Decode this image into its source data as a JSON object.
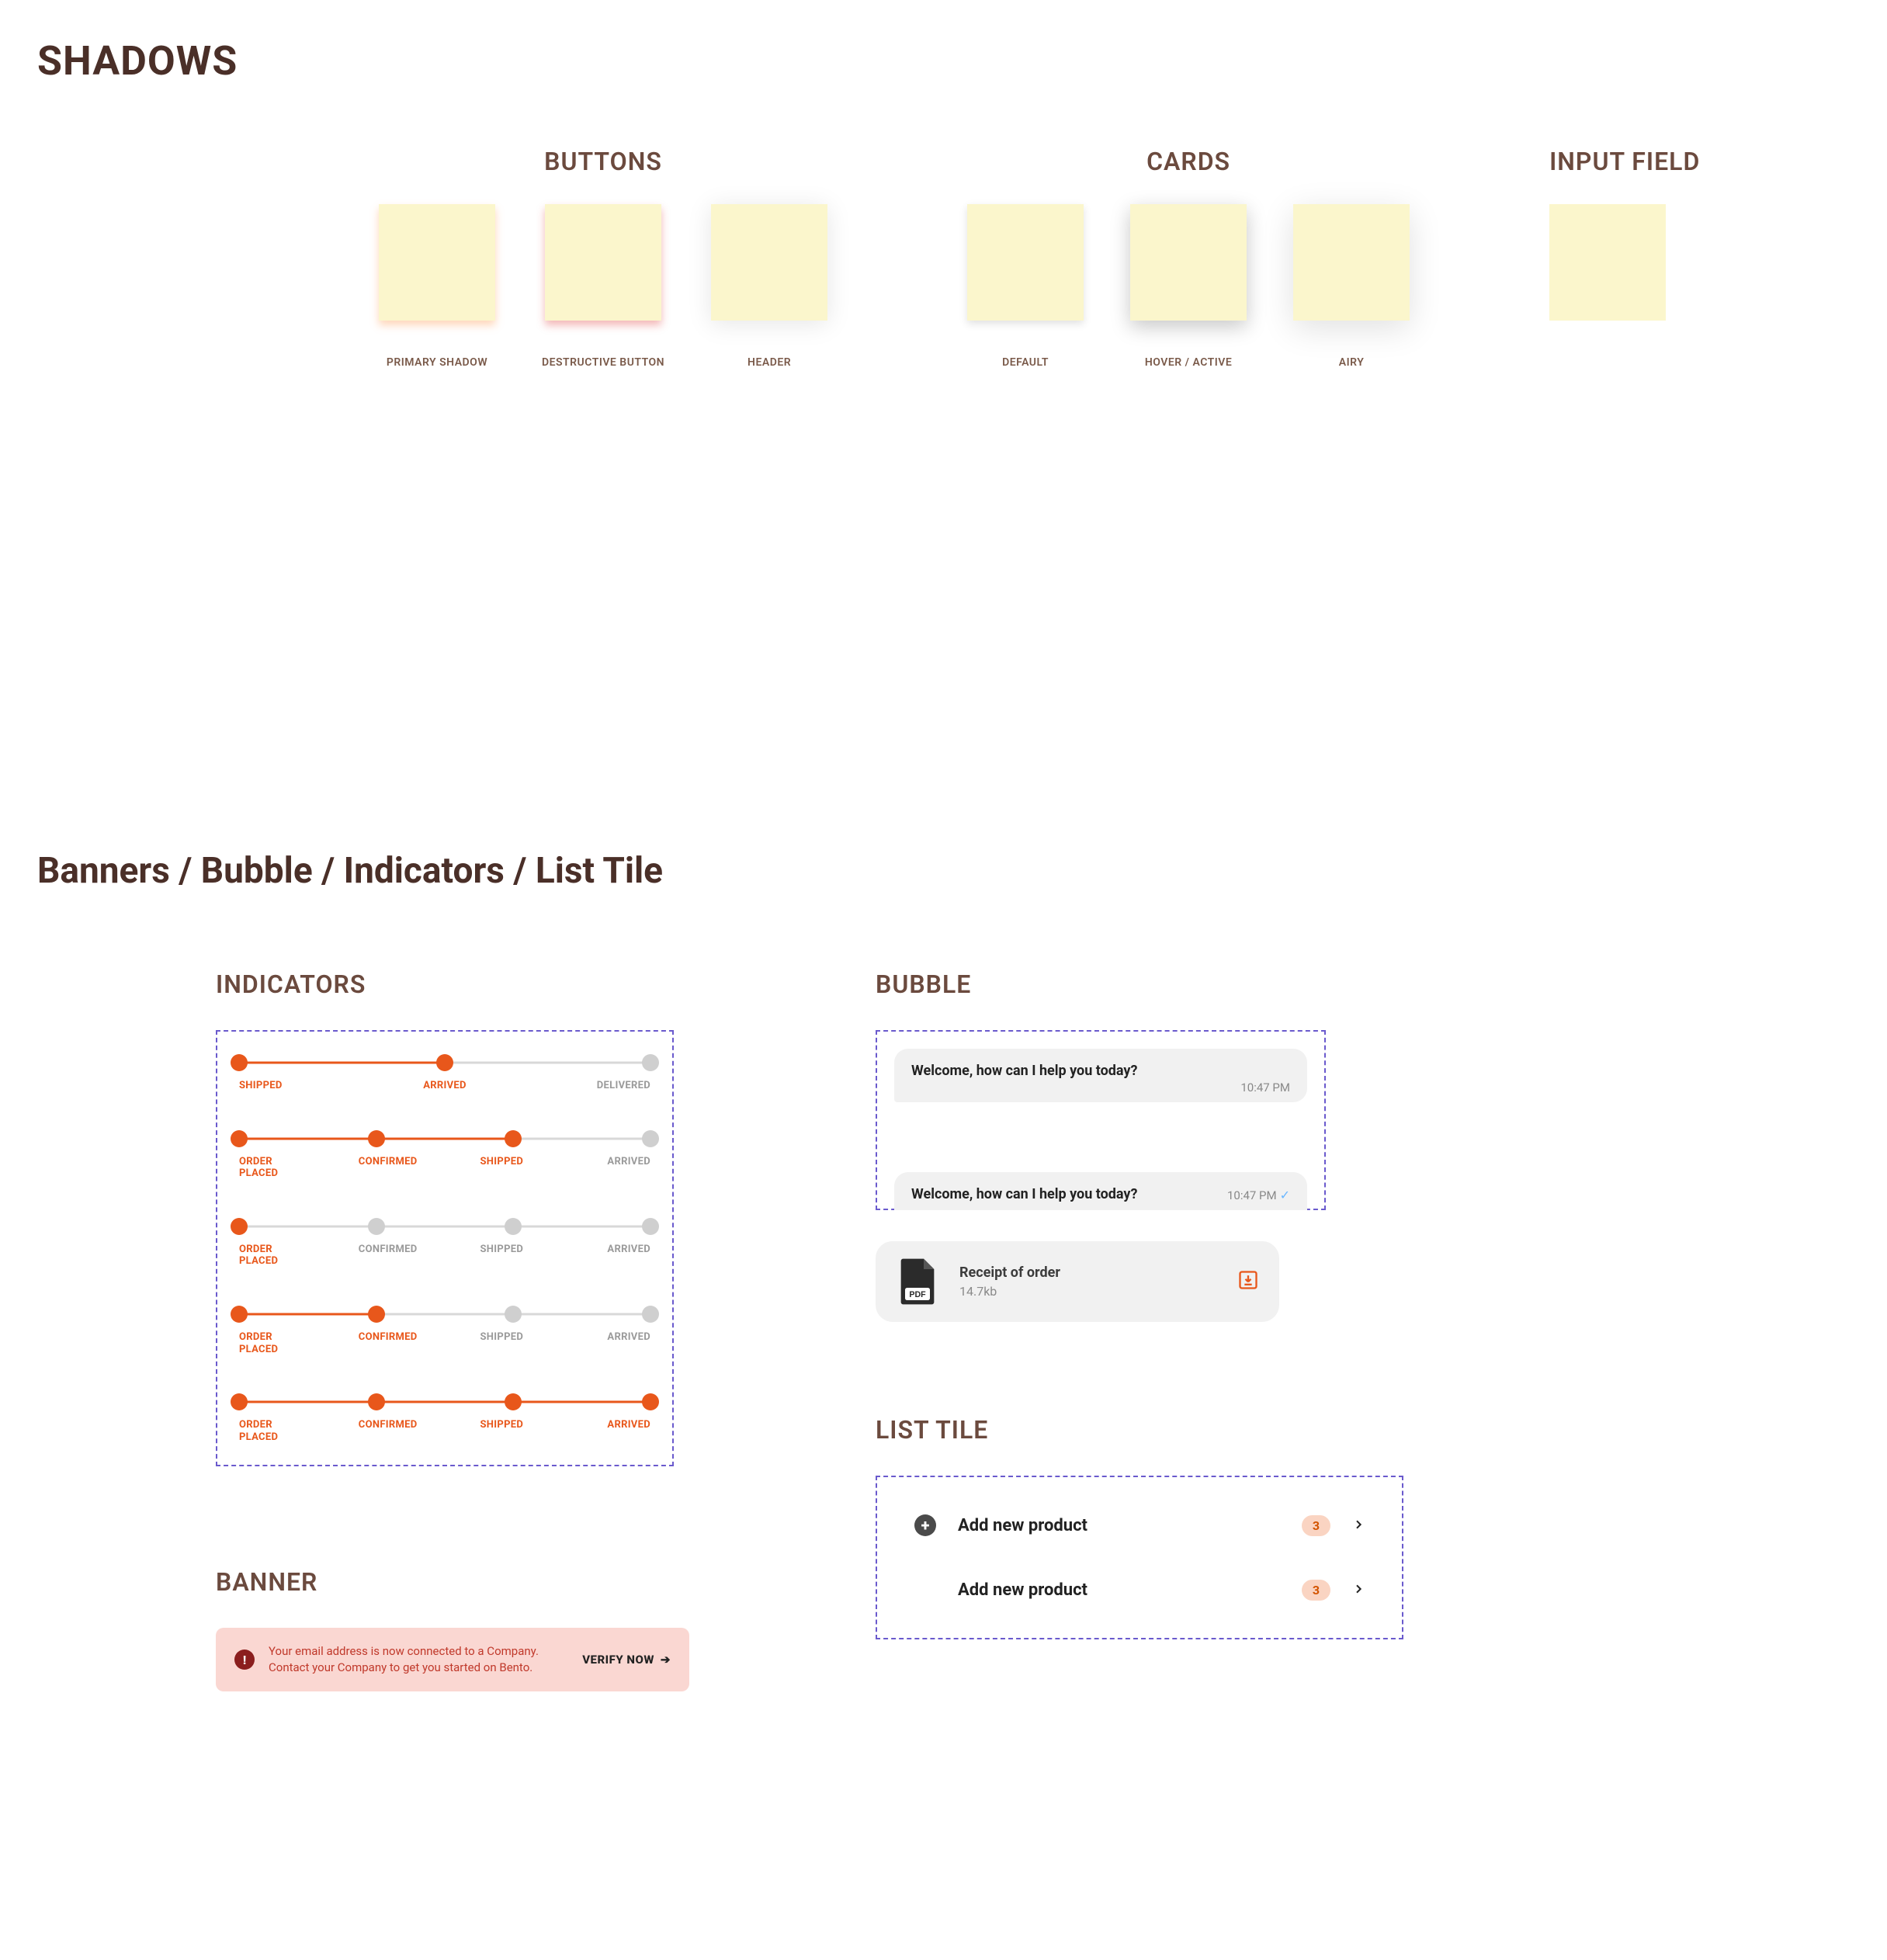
{
  "shadows": {
    "title": "SHADOWS",
    "groups": {
      "buttons": {
        "heading": "BUTTONS",
        "items": [
          {
            "label": "PRIMARY SHADOW"
          },
          {
            "label": "DESTRUCTIVE BUTTON"
          },
          {
            "label": "HEADER"
          }
        ]
      },
      "cards": {
        "heading": "CARDS",
        "items": [
          {
            "label": "DEFAULT"
          },
          {
            "label": "HOVER / ACTIVE"
          },
          {
            "label": "AIRY"
          }
        ]
      },
      "input": {
        "heading": "INPUT FIELD"
      }
    }
  },
  "section2_title": "Banners / Bubble / Indicators / List Tile",
  "indicators": {
    "heading": "INDICATORS",
    "rows": [
      {
        "steps": [
          "SHIPPED",
          "ARRIVED",
          "DELIVERED"
        ],
        "active_count": 2
      },
      {
        "steps": [
          "ORDER PLACED",
          "CONFIRMED",
          "SHIPPED",
          "ARRIVED"
        ],
        "active_count": 3
      },
      {
        "steps": [
          "ORDER PLACED",
          "CONFIRMED",
          "SHIPPED",
          "ARRIVED"
        ],
        "active_count": 1
      },
      {
        "steps": [
          "ORDER PLACED",
          "CONFIRMED",
          "SHIPPED",
          "ARRIVED"
        ],
        "active_count": 2
      },
      {
        "steps": [
          "ORDER PLACED",
          "CONFIRMED",
          "SHIPPED",
          "ARRIVED"
        ],
        "active_count": 4
      }
    ]
  },
  "bubble": {
    "heading": "BUBBLE",
    "messages": [
      {
        "text": "Welcome, how can I help you today?",
        "time": "10:47 PM",
        "read": false
      },
      {
        "text": "Welcome, how can I help you today?",
        "time": "10:47 PM",
        "read": true
      }
    ],
    "file": {
      "title": "Receipt of order",
      "size": "14.7kb"
    }
  },
  "banner": {
    "heading": "BANNER",
    "text": "Your email address is now connected to a Company. Contact your Company to get you started on Bento.",
    "action": "VERIFY NOW"
  },
  "listtile": {
    "heading": "LIST TILE",
    "items": [
      {
        "label": "Add new product",
        "count": "3",
        "with_icon": true
      },
      {
        "label": "Add new product",
        "count": "3",
        "with_icon": false
      }
    ]
  }
}
